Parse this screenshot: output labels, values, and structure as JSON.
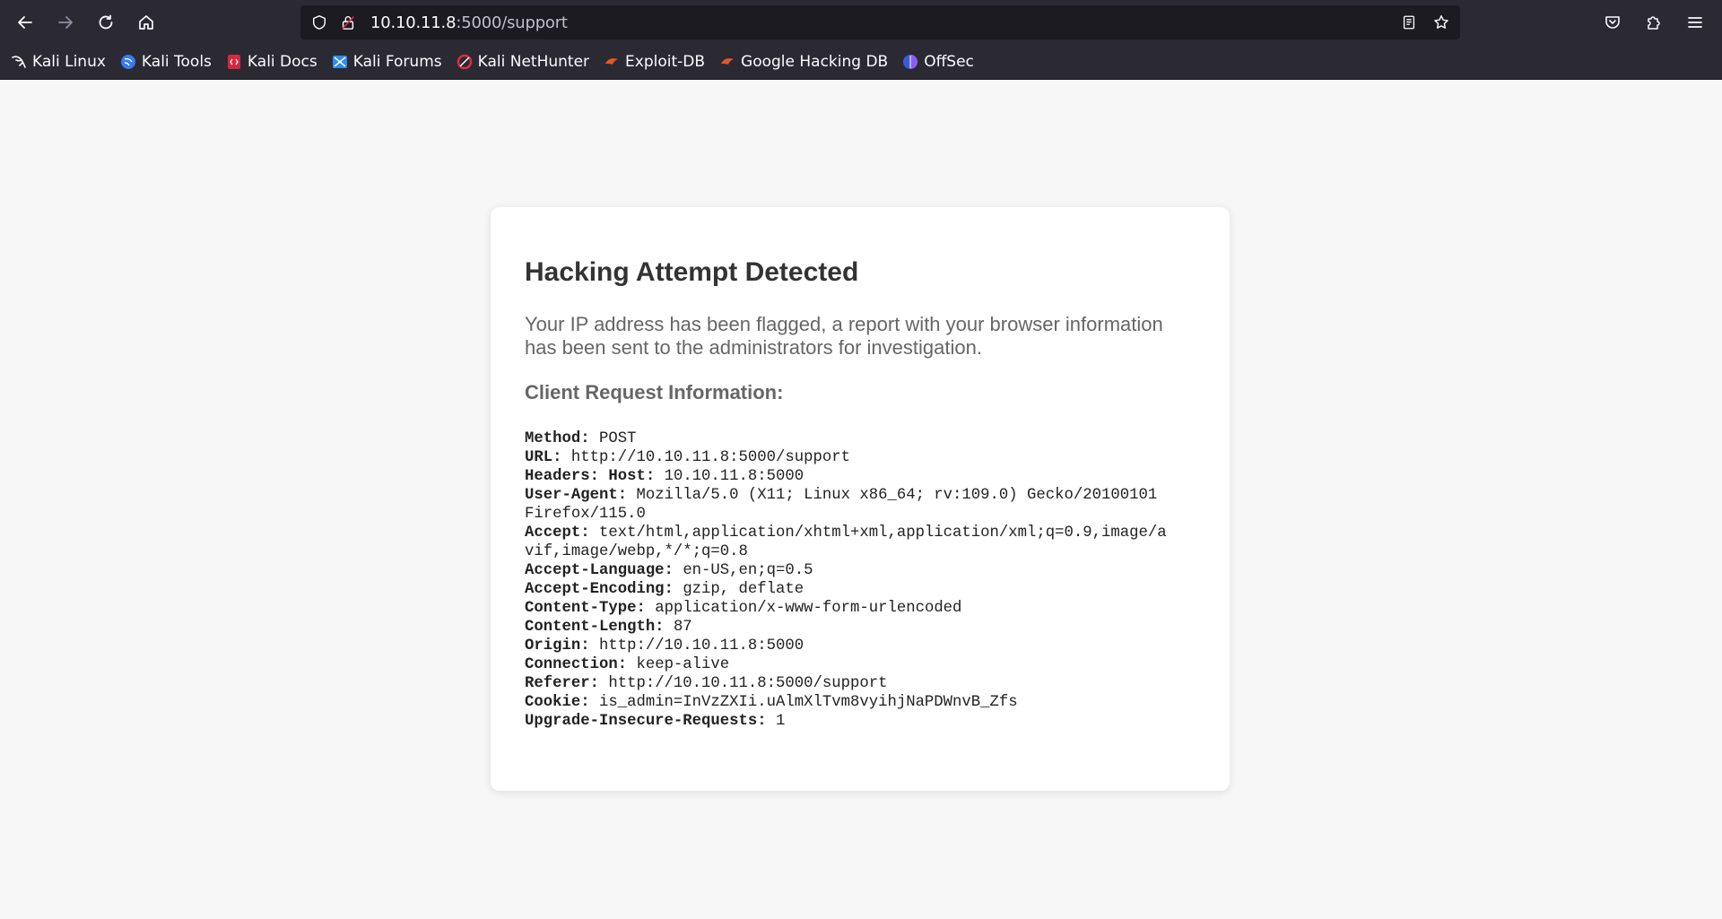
{
  "browser": {
    "url_host": "10.10.11.8",
    "url_path": ":5000/support",
    "bookmarks": [
      {
        "label": "Kali Linux",
        "icon": "kali-dragon-icon"
      },
      {
        "label": "Kali Tools",
        "icon": "kali-tools-icon"
      },
      {
        "label": "Kali Docs",
        "icon": "kali-docs-icon"
      },
      {
        "label": "Kali Forums",
        "icon": "kali-forums-icon"
      },
      {
        "label": "Kali NetHunter",
        "icon": "kali-nethunter-icon"
      },
      {
        "label": "Exploit-DB",
        "icon": "exploit-db-icon"
      },
      {
        "label": "Google Hacking DB",
        "icon": "google-hacking-db-icon"
      },
      {
        "label": "OffSec",
        "icon": "offsec-icon"
      }
    ]
  },
  "page": {
    "title": "Hacking Attempt Detected",
    "message": "Your IP address has been flagged, a report with your browser information has been sent to the administrators for investigation.",
    "section_title": "Client Request Information:",
    "request": {
      "method_label": "Method:",
      "method": "POST",
      "url_label": "URL:",
      "url": "http://10.10.11.8:5000/support",
      "headers_label": "Headers:",
      "headers": [
        {
          "key": "Host:",
          "value": "10.10.11.8:5000"
        },
        {
          "key": "User-Agent:",
          "value": "Mozilla/5.0 (X11; Linux x86_64; rv:109.0) Gecko/20100101 Firefox/115.0"
        },
        {
          "key": "Accept:",
          "value": "text/html,application/xhtml+xml,application/xml;q=0.9,image/avif,image/webp,*/*;q=0.8"
        },
        {
          "key": "Accept-Language:",
          "value": "en-US,en;q=0.5"
        },
        {
          "key": "Accept-Encoding:",
          "value": "gzip, deflate"
        },
        {
          "key": "Content-Type:",
          "value": "application/x-www-form-urlencoded"
        },
        {
          "key": "Content-Length:",
          "value": "87"
        },
        {
          "key": "Origin:",
          "value": "http://10.10.11.8:5000"
        },
        {
          "key": "Connection:",
          "value": "keep-alive"
        },
        {
          "key": "Referer:",
          "value": "http://10.10.11.8:5000/support"
        },
        {
          "key": "Cookie:",
          "value": "is_admin=InVzZXIi.uAlmXlTvm8vyihjNaPDWnvB_Zfs"
        },
        {
          "key": "Upgrade-Insecure-Requests:",
          "value": "1"
        }
      ]
    }
  }
}
